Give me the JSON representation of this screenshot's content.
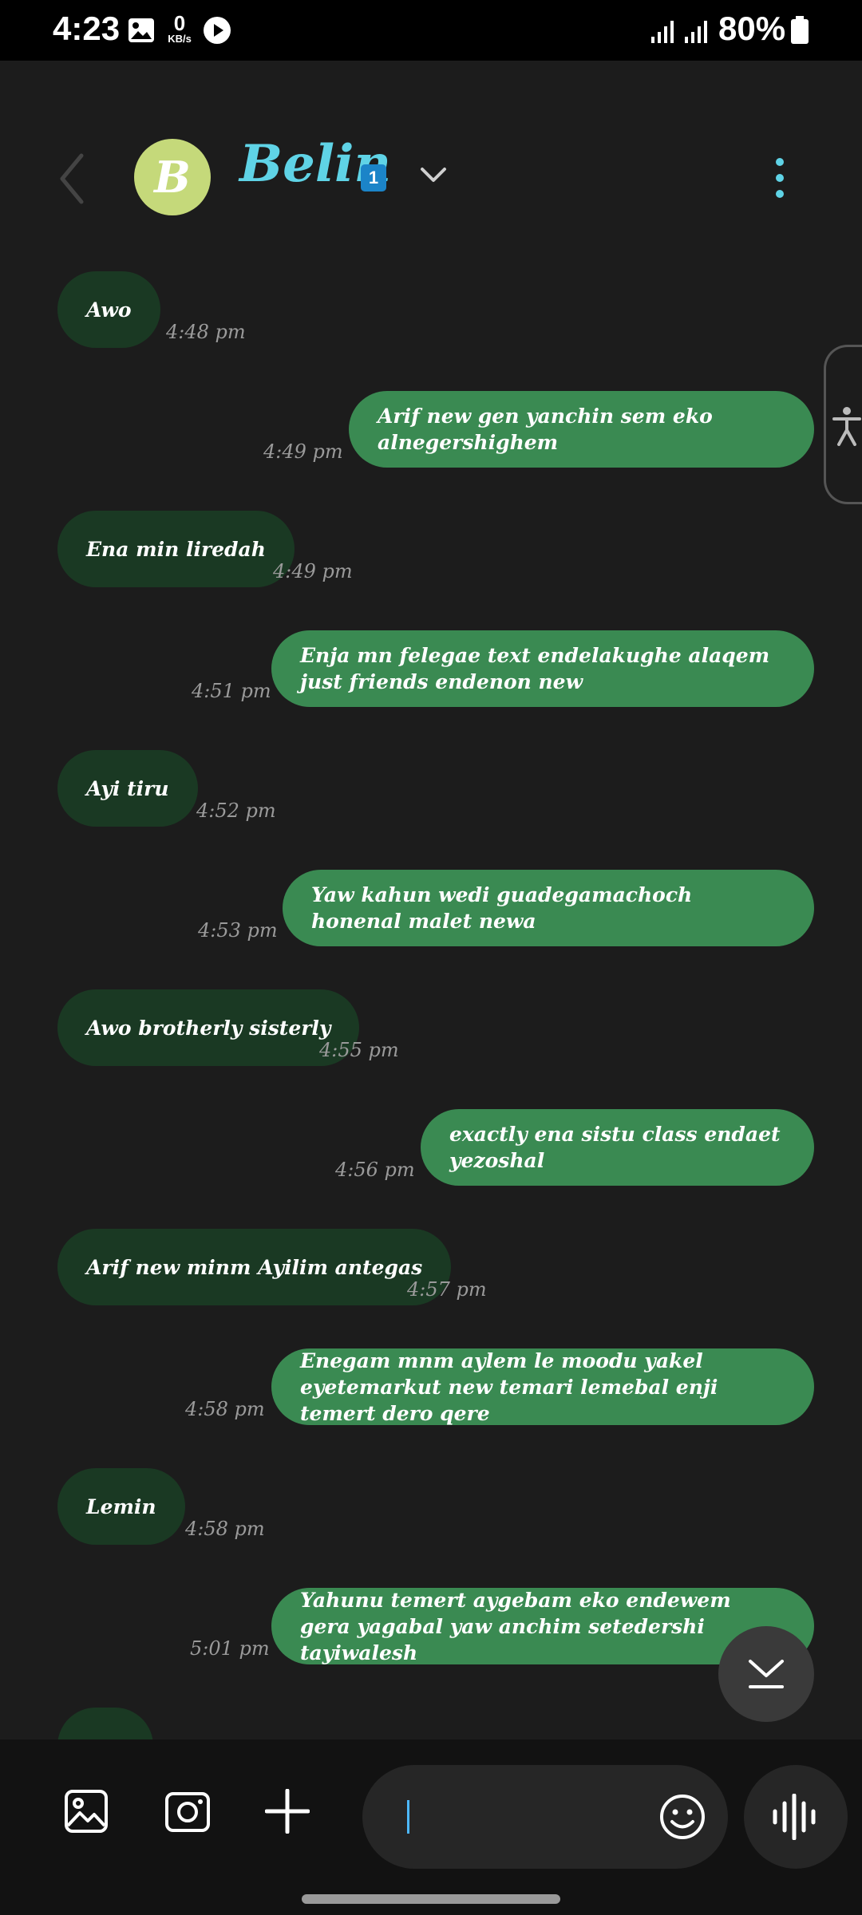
{
  "status_bar": {
    "time": "4:23",
    "net_speed": "0",
    "net_speed_unit": "KB/s",
    "battery_percent": "80%"
  },
  "header": {
    "avatar_letter": "B",
    "contact_name": "Belin",
    "sim_badge": "1"
  },
  "messages": [
    {
      "direction": "in",
      "text": "Awo",
      "time": "4:48 pm"
    },
    {
      "direction": "out",
      "text": "Arif new gen yanchin sem eko alnegershighem",
      "time": "4:49 pm"
    },
    {
      "direction": "in",
      "text": "Ena min liredah",
      "time": "4:49 pm"
    },
    {
      "direction": "out",
      "text": "Enja mn felegae text endelakughe alaqem just friends endenon new",
      "time": "4:51 pm"
    },
    {
      "direction": "in",
      "text": "Ayi tiru",
      "time": "4:52 pm"
    },
    {
      "direction": "out",
      "text": "Yaw kahun wedi guadegamachoch honenal malet newa",
      "time": "4:53 pm"
    },
    {
      "direction": "in",
      "text": "Awo brotherly sisterly",
      "time": "4:55 pm"
    },
    {
      "direction": "out",
      "text": "exactly ena sistu class endaet yezoshal",
      "time": "4:56 pm"
    },
    {
      "direction": "in",
      "text": "Arif new minm Ayilim antegas",
      "time": "4:57 pm"
    },
    {
      "direction": "out",
      "text": "Enegam mnm aylem le moodu yakel eyetemarkut new temari lemebal enji temert dero qere",
      "time": "4:58 pm"
    },
    {
      "direction": "in",
      "text": "Lemin",
      "time": "4:58 pm"
    },
    {
      "direction": "out",
      "text": "Yahunu temert aygebam eko endewem gera yagabal yaw anchim setedershi tayiwalesh",
      "time": "5:01 pm"
    }
  ],
  "composer": {
    "text_value": ""
  },
  "icons": {
    "gallery": "gallery-icon",
    "camera": "camera-icon",
    "add": "plus-icon",
    "emoji": "emoji-icon",
    "voice": "voice-wave-icon",
    "scroll_down": "scroll-down-icon",
    "accessibility": "accessibility-icon"
  },
  "colors": {
    "incoming_bubble": "#1a3923",
    "outgoing_bubble": "#3a8a52",
    "contact_name": "#5fd3e6",
    "avatar": "#c5d97a",
    "background": "#1c1c1c"
  }
}
